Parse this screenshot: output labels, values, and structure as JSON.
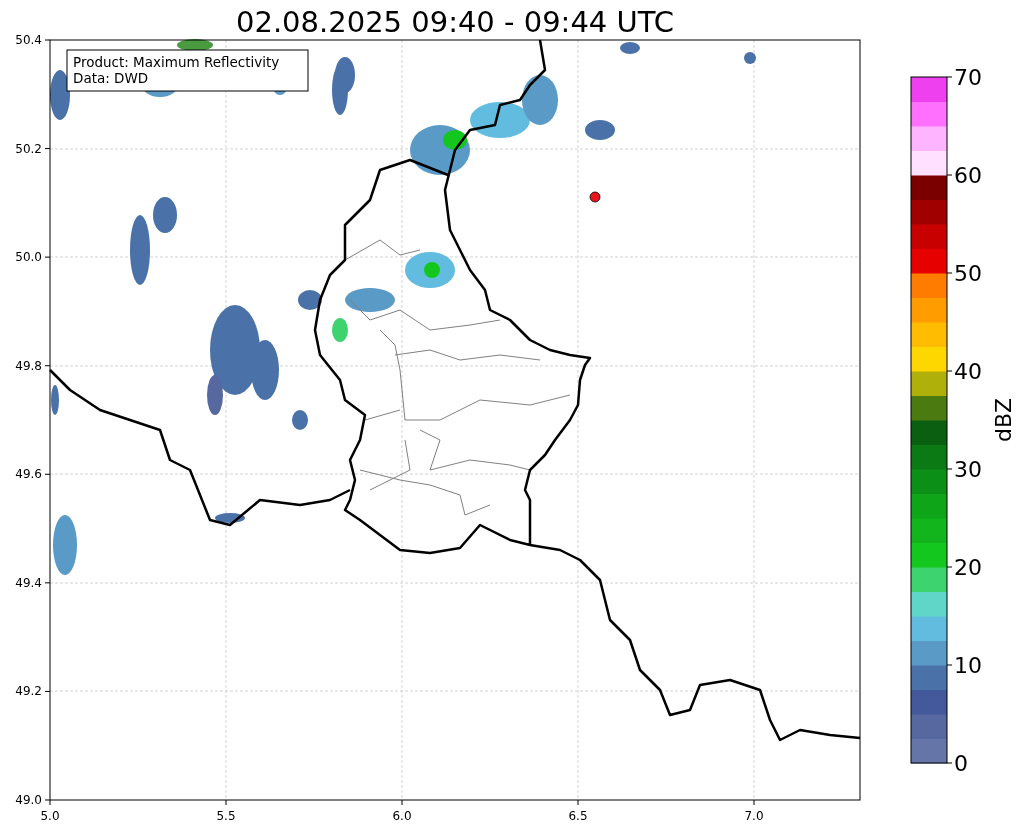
{
  "title": "02.08.2025 09:40 - 09:44 UTC",
  "map": {
    "info_box": [
      "Product: Maximum Reflectivity",
      "Data: DWD"
    ],
    "x_ticks": [
      "5.0",
      "5.5",
      "6.0",
      "6.5",
      "7.0"
    ],
    "y_ticks": [
      "50.4",
      "50.2",
      "50.0",
      "49.8",
      "49.6",
      "49.4",
      "49.2",
      "49.0"
    ]
  },
  "colorbar": {
    "label": "dBZ",
    "ticks": [
      "70",
      "60",
      "50",
      "40",
      "30",
      "20",
      "10",
      "0"
    ],
    "bands": [
      {
        "color": "#6675a8"
      },
      {
        "color": "#56689f"
      },
      {
        "color": "#44599c"
      },
      {
        "color": "#4a72a8"
      },
      {
        "color": "#5a9ac6"
      },
      {
        "color": "#62bce0"
      },
      {
        "color": "#60d6c8"
      },
      {
        "color": "#3dd36f"
      },
      {
        "color": "#14c71e"
      },
      {
        "color": "#12b51c"
      },
      {
        "color": "#0fa518"
      },
      {
        "color": "#0c8f16"
      },
      {
        "color": "#0b7a14"
      },
      {
        "color": "#0a5f10"
      },
      {
        "color": "#4a7a10"
      },
      {
        "color": "#b0b00a"
      },
      {
        "color": "#ffd700"
      },
      {
        "color": "#ffbc00"
      },
      {
        "color": "#ff9c00"
      },
      {
        "color": "#ff7c00"
      },
      {
        "color": "#e60000"
      },
      {
        "color": "#c80000"
      },
      {
        "color": "#a00000"
      },
      {
        "color": "#7a0000"
      },
      {
        "color": "#ffe0ff"
      },
      {
        "color": "#ffb4ff"
      },
      {
        "color": "#ff70ff"
      },
      {
        "color": "#ee40ee"
      }
    ]
  }
}
